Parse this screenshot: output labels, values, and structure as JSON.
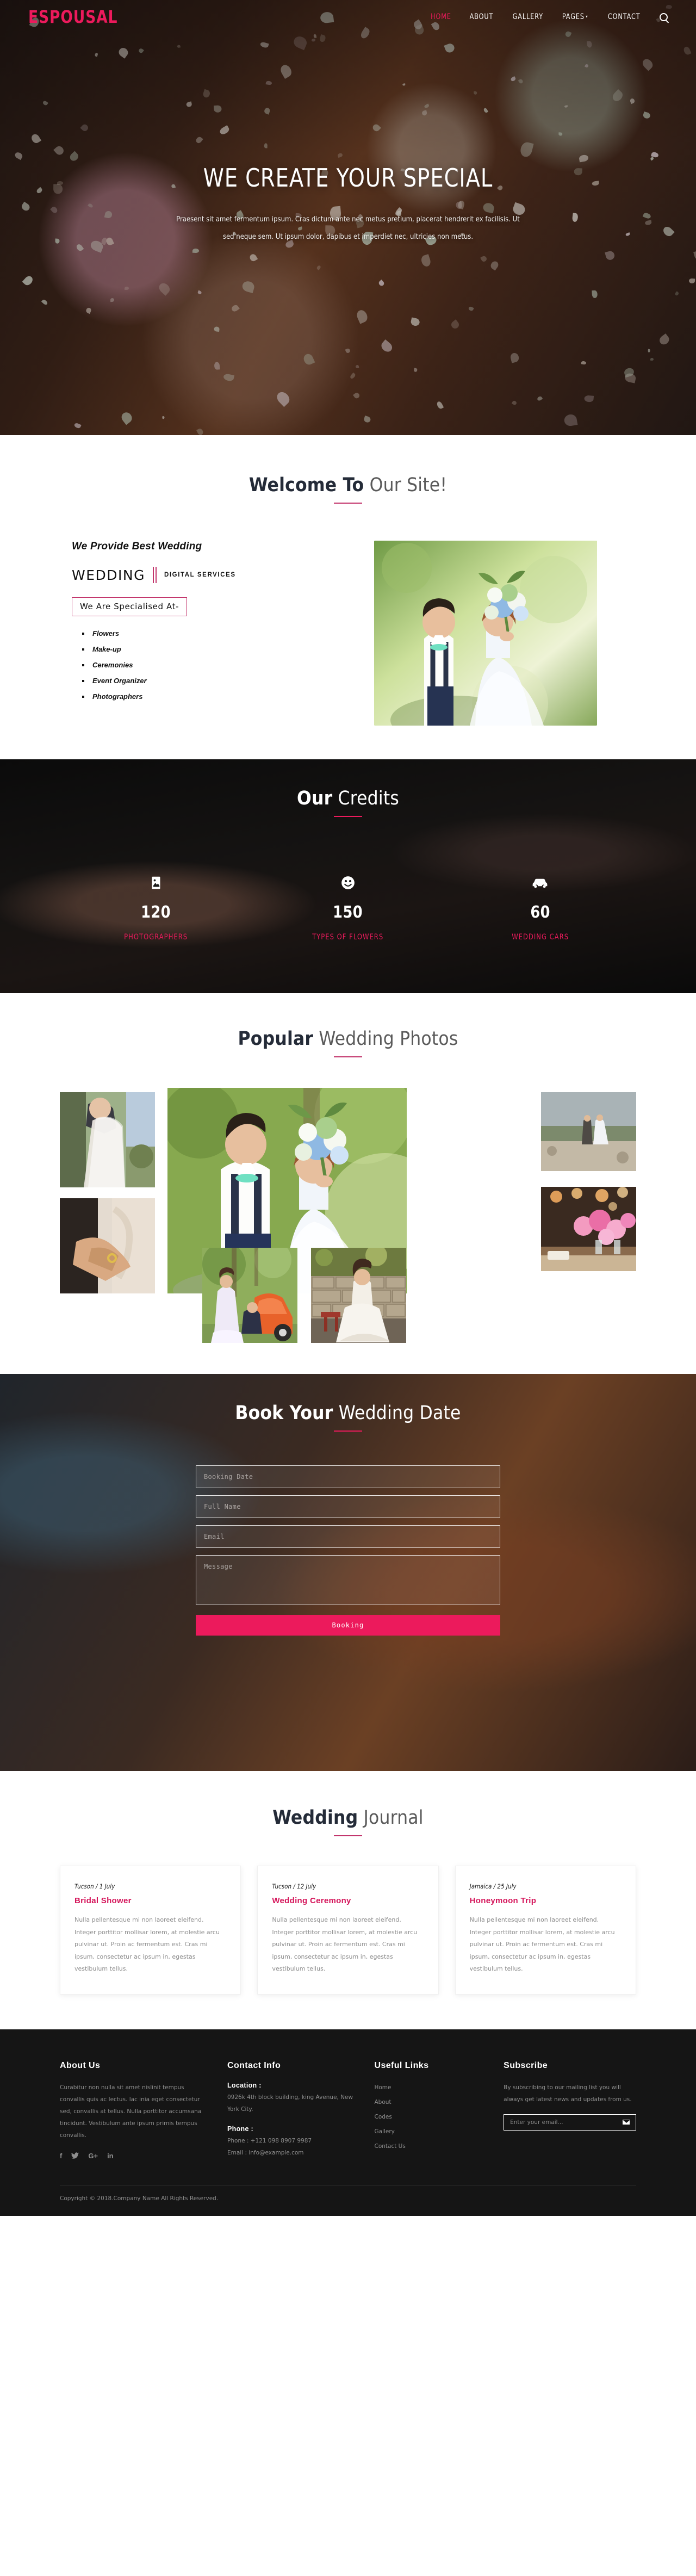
{
  "brand": {
    "logo": "ESPOUSAL",
    "accent": "#ec1a5c",
    "dark": "#242b38"
  },
  "nav": {
    "items": [
      {
        "label": "HOME",
        "active": true
      },
      {
        "label": "ABOUT",
        "active": false
      },
      {
        "label": "GALLERY",
        "active": false
      },
      {
        "label": "PAGES",
        "active": false,
        "caret": "▾"
      },
      {
        "label": "CONTACT",
        "active": false
      }
    ],
    "search_icon": "search-icon"
  },
  "hero": {
    "title": "WE CREATE YOUR SPECIAL",
    "subtitle": "Praesent sit amet fermentum ipsum. Cras dictum ante nec metus pretium, placerat hendrerit ex facilisis. Ut sed neque sem. Ut ipsum dolor, dapibus et imperdiet nec, ultricies non metus."
  },
  "welcome": {
    "heading_bold": "Welcome To",
    "heading_light": " Our Site!",
    "subheading": "We Provide Best Wedding",
    "brand_word": "WEDDING",
    "brand_tag": "DIGITAL SERVICES",
    "specialised_label": "We Are Specialised At-",
    "specialities": [
      "Flowers",
      "Make-up",
      "Ceremonies",
      "Event Organizer",
      "Photographers"
    ]
  },
  "credits": {
    "heading_bold": "Our",
    "heading_light": " Credits",
    "stats": [
      {
        "icon": "image-icon",
        "value": "120",
        "label": "PHOTOGRAPHERS"
      },
      {
        "icon": "smiley-icon",
        "value": "150",
        "label": "TYPES OF FLOWERS"
      },
      {
        "icon": "car-icon",
        "value": "60",
        "label": "WEDDING CARS"
      }
    ]
  },
  "gallery": {
    "heading_bold": "Popular",
    "heading_light": " Wedding Photos",
    "photos": [
      {
        "name": "bride-veil-embrace"
      },
      {
        "name": "ring-exchange-hands"
      },
      {
        "name": "couple-bouquet-park"
      },
      {
        "name": "couple-lakeside"
      },
      {
        "name": "pink-flower-table-setting"
      },
      {
        "name": "bride-groom-orange-car"
      },
      {
        "name": "bride-stone-wall"
      }
    ]
  },
  "booking": {
    "heading_bold": "Book Your",
    "heading_light": " Wedding Date",
    "fields": {
      "date_placeholder": "Booking Date",
      "name_placeholder": "Full Name",
      "email_placeholder": "Email",
      "message_placeholder": "Message"
    },
    "submit_label": "Booking"
  },
  "journal": {
    "heading_bold": "Wedding",
    "heading_light": " Journal",
    "posts": [
      {
        "meta": "Tucson / 1 July",
        "title": "Bridal Shower",
        "text": "Nulla pellentesque mi non laoreet eleifend. Integer porttitor mollisar lorem, at molestie arcu pulvinar ut. Proin ac fermentum est. Cras mi ipsum, consectetur ac ipsum in, egestas vestibulum tellus."
      },
      {
        "meta": "Tucson / 12 July",
        "title": "Wedding Ceremony",
        "text": "Nulla pellentesque mi non laoreet eleifend. Integer porttitor mollisar lorem, at molestie arcu pulvinar ut. Proin ac fermentum est. Cras mi ipsum, consectetur ac ipsum in, egestas vestibulum tellus."
      },
      {
        "meta": "Jamaica / 25 July",
        "title": "Honeymoon Trip",
        "text": "Nulla pellentesque mi non laoreet eleifend. Integer porttitor mollisar lorem, at molestie arcu pulvinar ut. Proin ac fermentum est. Cras mi ipsum, consectetur ac ipsum in, egestas vestibulum tellus."
      }
    ]
  },
  "footer": {
    "about": {
      "title": "About Us",
      "text": "Curabitur non nulla sit amet nislinit tempus convallis quis ac lectus. lac inia eget consectetur sed, convallis at tellus. Nulla porttitor accumsana tincidunt. Vestibulum ante ipsum primis tempus convallis."
    },
    "social": [
      {
        "name": "facebook-icon",
        "glyph": "f"
      },
      {
        "name": "twitter-icon",
        "glyph": "❈"
      },
      {
        "name": "google-plus-icon",
        "glyph": "G+"
      },
      {
        "name": "linkedin-icon",
        "glyph": "in"
      }
    ],
    "contact": {
      "title": "Contact Info",
      "location_label": "Location :",
      "location_value": "0926k 4th block building, king Avenue, New York City.",
      "phone_label": "Phone :",
      "phone_value": "Phone : +121 098 8907 9987",
      "email_value": "Email : info@example.com"
    },
    "links": {
      "title": "Useful Links",
      "items": [
        "Home",
        "About",
        "Codes",
        "Gallery",
        "Contact Us"
      ]
    },
    "subscribe": {
      "title": "Subscribe",
      "text": "By subscribing to our mailing list you will always get latest news and updates from us.",
      "placeholder": "Enter your email...",
      "button_icon": "envelope-icon"
    },
    "copyright": "Copyright © 2018.Company Name All Rights Reserved."
  }
}
